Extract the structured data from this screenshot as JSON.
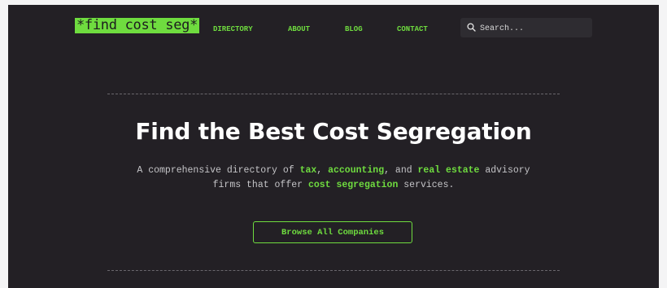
{
  "header": {
    "logo_text": "*find cost seg*",
    "nav": [
      "DIRECTORY",
      "ABOUT",
      "BLOG",
      "CONTACT"
    ],
    "search": {
      "placeholder": "Search...",
      "icon": "search-icon"
    }
  },
  "hero": {
    "title": "Find the Best Cost Segregation",
    "subtitle": {
      "line1": {
        "pre": "A comprehensive directory of ",
        "hl1": "tax",
        "sep1": ", ",
        "hl2": "accounting",
        "sep2": ", and ",
        "hl3": "real estate",
        "post": " advisory"
      },
      "line2": {
        "pre": "firms that offer ",
        "hl": "cost segregation",
        "post": " services."
      }
    },
    "cta_label": "Browse All Companies"
  },
  "colors": {
    "background": "#232025",
    "accent": "#6fdc3f",
    "title": "#ffffff",
    "body_text": "#c4c4c7"
  }
}
